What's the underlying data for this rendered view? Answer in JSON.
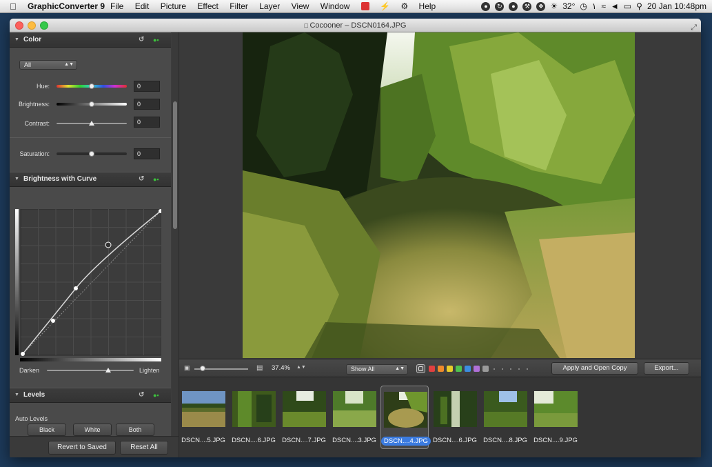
{
  "menubar": {
    "app_name": "GraphicConverter 9",
    "menus": [
      "File",
      "Edit",
      "Picture",
      "Effect",
      "Filter",
      "Layer",
      "View",
      "Window",
      "Help"
    ],
    "temperature": "32°",
    "date_time": "20 Jan  10:48pm"
  },
  "window": {
    "title": "Cocooner – DSCN0164.JPG"
  },
  "color_section": {
    "title": "Color",
    "channel_select": "All",
    "hue_label": "Hue:",
    "hue_value": "0",
    "brightness_label": "Brightness:",
    "brightness_value": "0",
    "contrast_label": "Contrast:",
    "contrast_value": "0",
    "saturation_label": "Saturation:",
    "saturation_value": "0"
  },
  "curve_section": {
    "title": "Brightness with Curve",
    "darken_label": "Darken",
    "lighten_label": "Lighten"
  },
  "levels_section": {
    "title": "Levels",
    "auto_levels_label": "Auto Levels",
    "black_button": "Black",
    "white_button": "White",
    "both_button": "Both"
  },
  "left_bottom": {
    "revert_button": "Revert to Saved",
    "reset_button": "Reset All"
  },
  "toolbar": {
    "zoom_value": "37.4%",
    "filter_select": "Show All",
    "apply_button": "Apply and Open Copy",
    "export_button": "Export...",
    "label_colors": [
      "#e04040",
      "#ee8a2a",
      "#e8cc2a",
      "#4fc24f",
      "#3c8de0",
      "#b070d8",
      "#9a9a9a"
    ]
  },
  "thumbnails": [
    {
      "label": "DSCN....5.JPG",
      "selected": false
    },
    {
      "label": "DSCN....6.JPG",
      "selected": false
    },
    {
      "label": "DSCN....7.JPG",
      "selected": false
    },
    {
      "label": "DSCN....3.JPG",
      "selected": false
    },
    {
      "label": "DSCN....4.JPG",
      "selected": true
    },
    {
      "label": "DSCN....6.JPG",
      "selected": false
    },
    {
      "label": "DSCN....8.JPG",
      "selected": false
    },
    {
      "label": "DSCN....9.JPG",
      "selected": false
    }
  ]
}
